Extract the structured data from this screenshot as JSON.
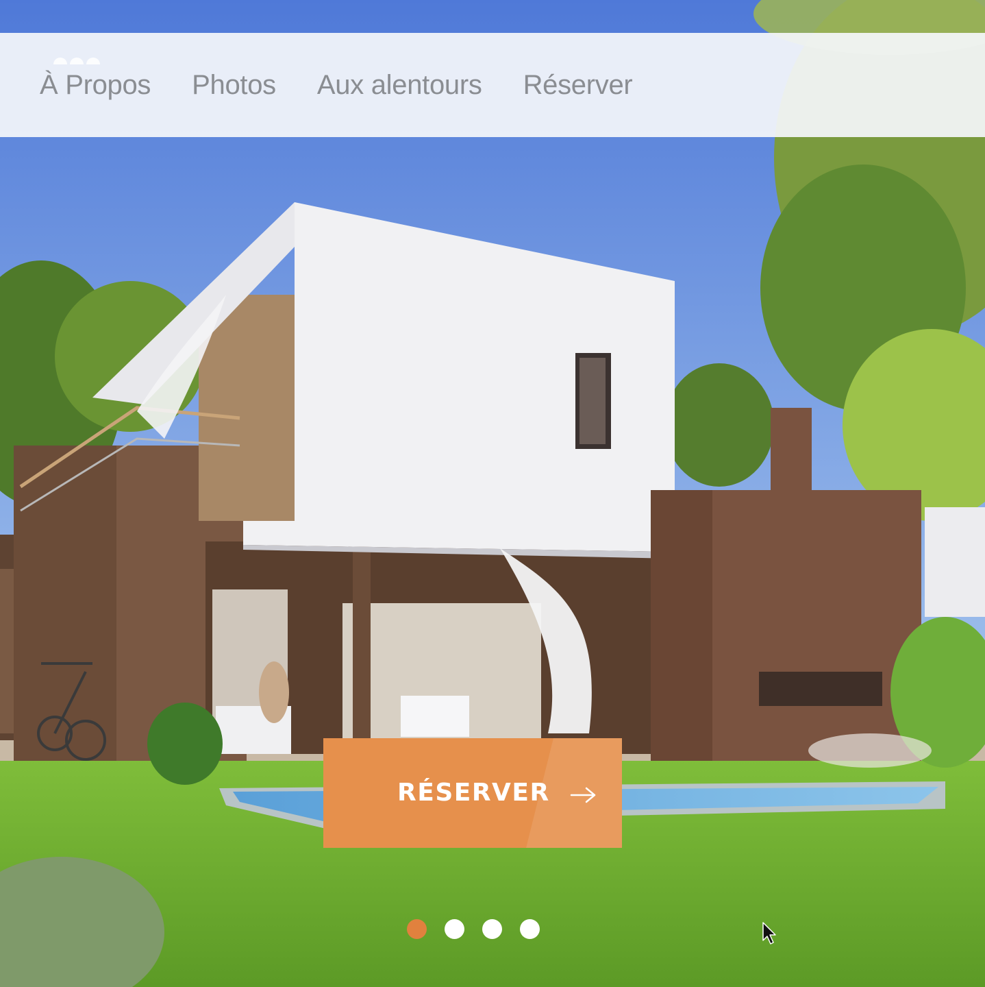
{
  "nav": {
    "items": [
      {
        "label": "À Propos"
      },
      {
        "label": "Photos"
      },
      {
        "label": "Aux alentours"
      },
      {
        "label": "Réserver"
      }
    ]
  },
  "hero": {
    "image": "modern-house-with-garden-and-pool",
    "cta_label": "RÉSERVER",
    "cta_icon": "arrow-right-icon"
  },
  "carousel": {
    "slide_count": 4,
    "active_index": 0
  },
  "colors": {
    "accent": "#e6904c",
    "active_dot": "#e1813e",
    "nav_text": "#8a8d92",
    "nav_bg": "#f4f6fa"
  }
}
